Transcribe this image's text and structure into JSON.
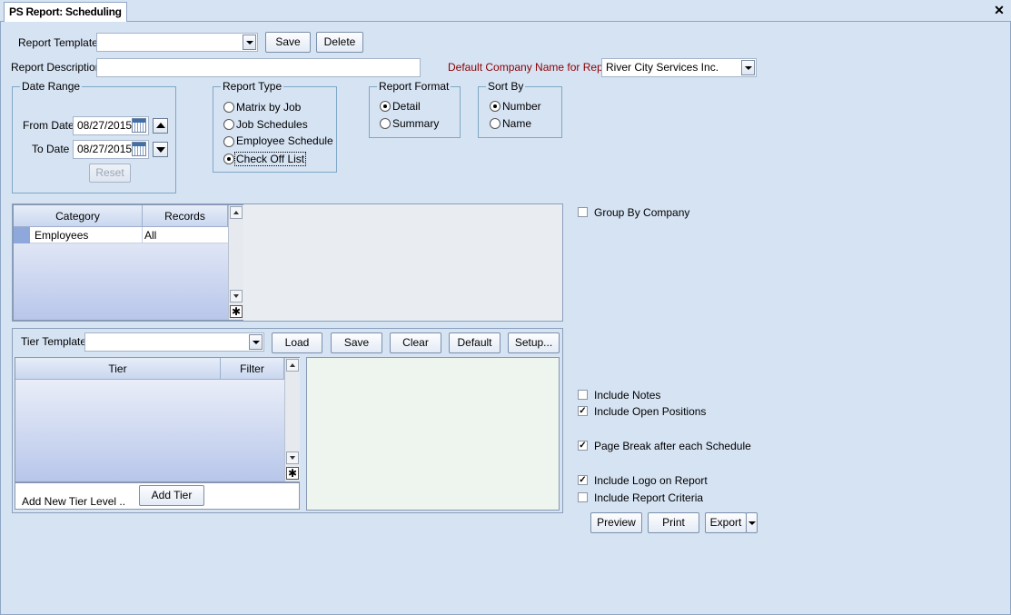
{
  "tab": {
    "title": "PS Report: Scheduling"
  },
  "window": {
    "close_symbol": "✕"
  },
  "report_template": {
    "label": "Report Template",
    "value": "",
    "save_label": "Save",
    "delete_label": "Delete"
  },
  "report_description": {
    "label": "Report Description",
    "value": ""
  },
  "default_company": {
    "label": "Default Company Name for Report",
    "value": "River City Services Inc.",
    "label_color": "#8b0000"
  },
  "date_range": {
    "title": "Date Range",
    "from_label": "From Date",
    "from_value": "08/27/2015",
    "to_label": "To Date",
    "to_value": "08/27/2015",
    "reset_label": "Reset"
  },
  "report_type": {
    "title": "Report Type",
    "options": [
      "Matrix by Job",
      "Job Schedules",
      "Employee Schedule",
      "Check Off List"
    ],
    "selected": "Check Off List"
  },
  "report_format": {
    "title": "Report Format",
    "options": [
      "Detail",
      "Summary"
    ],
    "selected": "Detail"
  },
  "sort_by": {
    "title": "Sort By",
    "options": [
      "Number",
      "Name"
    ],
    "selected": "Number"
  },
  "category_grid": {
    "columns": [
      "Category",
      "Records"
    ],
    "rows": [
      {
        "category": "Employees",
        "records": "All"
      }
    ]
  },
  "group_by_company": {
    "label": "Group By Company",
    "checked": false
  },
  "tier": {
    "template_label": "Tier Template",
    "template_value": "",
    "load_label": "Load",
    "save_label": "Save",
    "clear_label": "Clear",
    "default_label": "Default",
    "setup_label": "Setup...",
    "columns": [
      "Tier",
      "Filter"
    ],
    "add_new_label": "Add New Tier Level ..",
    "add_tier_label": "Add Tier"
  },
  "options": {
    "include_notes": {
      "label": "Include Notes",
      "checked": false
    },
    "include_open_positions": {
      "label": "Include Open Positions",
      "checked": true
    },
    "page_break": {
      "label": "Page Break after each Schedule",
      "checked": true
    },
    "include_logo": {
      "label": "Include Logo on Report",
      "checked": true
    },
    "include_criteria": {
      "label": "Include Report Criteria",
      "checked": false
    }
  },
  "actions": {
    "preview_label": "Preview",
    "print_label": "Print",
    "export_label": "Export"
  },
  "check_mark": "✓",
  "new_row_symbol": "✱"
}
